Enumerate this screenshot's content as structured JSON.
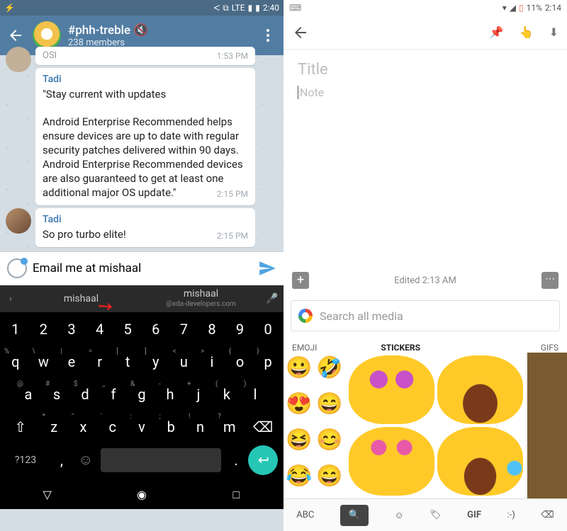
{
  "left": {
    "status": {
      "time": "2:40",
      "lte": "LTE"
    },
    "header": {
      "channel": "#phh-treble",
      "members": "238 members"
    },
    "messages": [
      {
        "time": "1:53 PM"
      },
      {
        "sender": "Tadi",
        "text": "\"Stay current with updates\n\nAndroid Enterprise Recommended helps ensure devices are up to date with regular security patches delivered within 90 days. Android Enterprise Recommended devices are also guaranteed to get at least one additional major OS update.\"",
        "time": "2:15 PM"
      },
      {
        "sender": "Tadi",
        "text": "So pro turbo elite!",
        "time": "2:15 PM"
      }
    ],
    "input": {
      "value": "Email me at mishaal"
    },
    "suggestions": {
      "primary": "mishaal",
      "secondary": "mishaal",
      "secondary_sub": "@xda-developers.com"
    },
    "keyboard": {
      "row_num": [
        "1",
        "2",
        "3",
        "4",
        "5",
        "6",
        "7",
        "8",
        "9",
        "0"
      ],
      "row1": [
        {
          "sup": "%",
          "k": "q"
        },
        {
          "sup": "\\",
          "k": "w"
        },
        {
          "sup": "|",
          "k": "e"
        },
        {
          "sup": "=",
          "k": "r"
        },
        {
          "sup": "[",
          "k": "t"
        },
        {
          "sup": "]",
          "k": "y"
        },
        {
          "sup": "<",
          "k": "u"
        },
        {
          "sup": ">",
          "k": "i"
        },
        {
          "sup": "{",
          "k": "o"
        },
        {
          "sup": "}",
          "k": "p"
        }
      ],
      "row2": [
        {
          "sup": "@",
          "k": "a"
        },
        {
          "sup": "#",
          "k": "s"
        },
        {
          "sup": "$",
          "k": "d"
        },
        {
          "sup": "_",
          "k": "f"
        },
        {
          "sup": "&",
          "k": "g"
        },
        {
          "sup": "-",
          "k": "h"
        },
        {
          "sup": "+",
          "k": "j"
        },
        {
          "sup": "(",
          "k": "k"
        },
        {
          "sup": ")",
          "k": "l"
        }
      ],
      "row3": [
        {
          "sup": "*",
          "k": "z"
        },
        {
          "sup": "\"",
          "k": "x"
        },
        {
          "sup": "'",
          "k": "c"
        },
        {
          "sup": ":",
          "k": "v"
        },
        {
          "sup": ";",
          "k": "b"
        },
        {
          "sup": "!",
          "k": "n"
        },
        {
          "sup": "?",
          "k": "m"
        }
      ],
      "sym": "?123",
      "comma": ",",
      "period": "."
    }
  },
  "right": {
    "status": {
      "battery": "11%",
      "time": "2:14"
    },
    "title_placeholder": "Title",
    "note_placeholder": "Note",
    "footer": {
      "edited": "Edited 2:13 AM"
    },
    "search_placeholder": "Search all media",
    "tabs": {
      "emoji": "EMOJI",
      "stickers": "STICKERS",
      "gifs": "GIFS"
    },
    "emoji_grid": [
      "😀",
      "🤣",
      "😍",
      "😄",
      "😆",
      "😊",
      "😂",
      "😄"
    ],
    "bottom_bar": {
      "abc": "ABC",
      "gif": "GIF",
      "text": ":-)"
    }
  }
}
